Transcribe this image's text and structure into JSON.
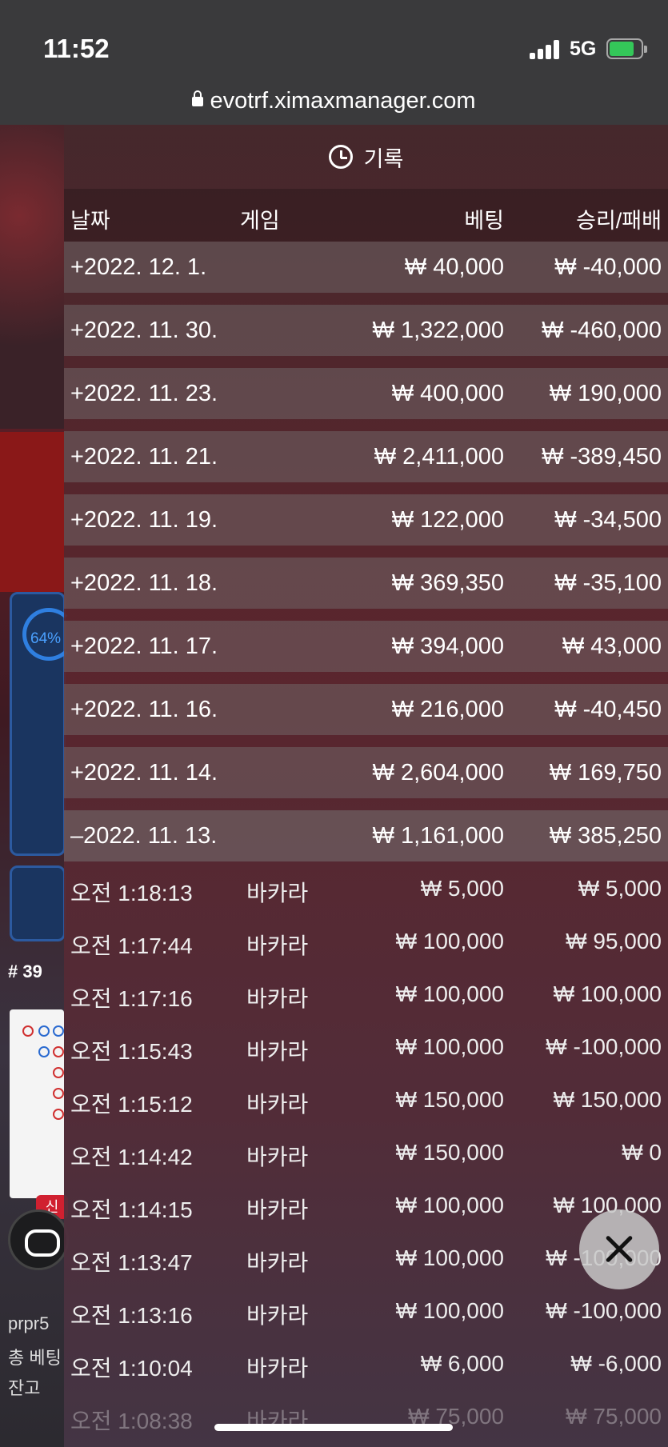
{
  "status_bar": {
    "time": "11:52",
    "network": "5G"
  },
  "browser": {
    "url": "evotrf.ximaxmanager.com"
  },
  "background": {
    "progress_percent": "64%",
    "round_number": "# 39",
    "new_badge": "신",
    "username": "prpr5",
    "total_bet_label": "총 베팅",
    "balance_label": "잔고"
  },
  "history": {
    "title": "기록",
    "columns": {
      "date": "날짜",
      "game": "게임",
      "bet": "베팅",
      "win_loss": "승리/패배"
    },
    "days": [
      {
        "date": "+2022. 12. 1.",
        "bet": "₩ 40,000",
        "win_loss": "₩ -40,000"
      },
      {
        "date": "+2022. 11. 30.",
        "bet": "₩ 1,322,000",
        "win_loss": "₩ -460,000"
      },
      {
        "date": "+2022. 11. 23.",
        "bet": "₩ 400,000",
        "win_loss": "₩ 190,000"
      },
      {
        "date": "+2022. 11. 21.",
        "bet": "₩ 2,411,000",
        "win_loss": "₩ -389,450"
      },
      {
        "date": "+2022. 11. 19.",
        "bet": "₩ 122,000",
        "win_loss": "₩ -34,500"
      },
      {
        "date": "+2022. 11. 18.",
        "bet": "₩ 369,350",
        "win_loss": "₩ -35,100"
      },
      {
        "date": "+2022. 11. 17.",
        "bet": "₩ 394,000",
        "win_loss": "₩ 43,000"
      },
      {
        "date": "+2022. 11. 16.",
        "bet": "₩ 216,000",
        "win_loss": "₩ -40,450"
      },
      {
        "date": "+2022. 11. 14.",
        "bet": "₩ 2,604,000",
        "win_loss": "₩ 169,750"
      },
      {
        "date": "–2022. 11. 13.",
        "bet": "₩ 1,161,000",
        "win_loss": "₩ 385,250"
      }
    ],
    "transactions": [
      {
        "time": "오전 1:18:13",
        "game": "바카라",
        "bet": "₩ 5,000",
        "win_loss": "₩ 5,000"
      },
      {
        "time": "오전 1:17:44",
        "game": "바카라",
        "bet": "₩ 100,000",
        "win_loss": "₩ 95,000"
      },
      {
        "time": "오전 1:17:16",
        "game": "바카라",
        "bet": "₩ 100,000",
        "win_loss": "₩ 100,000"
      },
      {
        "time": "오전 1:15:43",
        "game": "바카라",
        "bet": "₩ 100,000",
        "win_loss": "₩ -100,000"
      },
      {
        "time": "오전 1:15:12",
        "game": "바카라",
        "bet": "₩ 150,000",
        "win_loss": "₩ 150,000"
      },
      {
        "time": "오전 1:14:42",
        "game": "바카라",
        "bet": "₩ 150,000",
        "win_loss": "₩ 0"
      },
      {
        "time": "오전 1:14:15",
        "game": "바카라",
        "bet": "₩ 100,000",
        "win_loss": "₩ 100,000"
      },
      {
        "time": "오전 1:13:47",
        "game": "바카라",
        "bet": "₩ 100,000",
        "win_loss": "₩ -100,000"
      },
      {
        "time": "오전 1:13:16",
        "game": "바카라",
        "bet": "₩ 100,000",
        "win_loss": "₩ -100,000"
      },
      {
        "time": "오전 1:10:04",
        "game": "바카라",
        "bet": "₩ 6,000",
        "win_loss": "₩ -6,000"
      },
      {
        "time": "오전 1:08:38",
        "game": "바카라",
        "bet": "₩ 75,000",
        "win_loss": "₩ 75,000"
      }
    ]
  }
}
